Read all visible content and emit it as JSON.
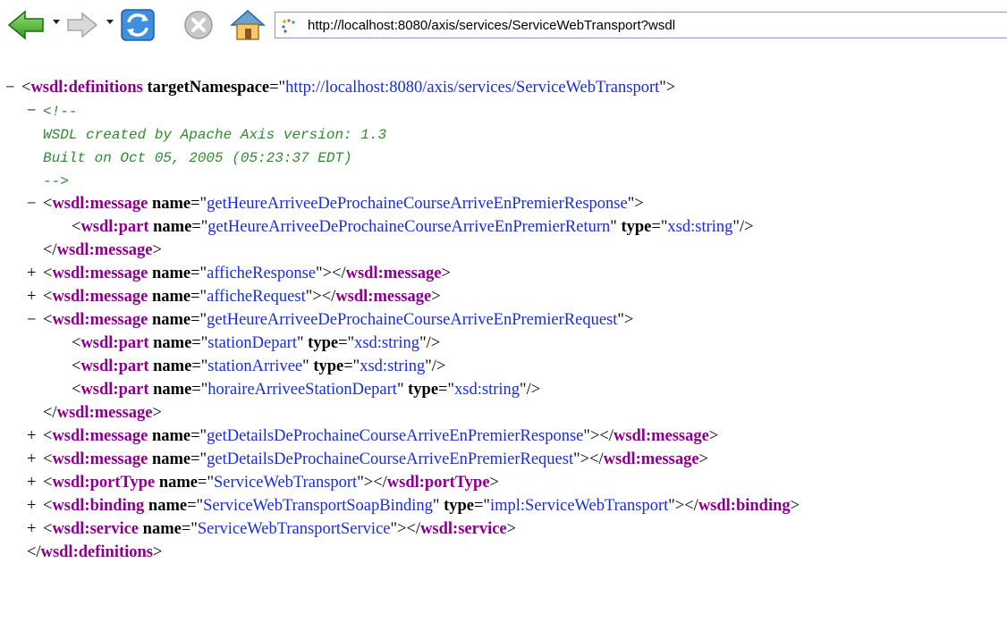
{
  "browser": {
    "url": "http://localhost:8080/axis/services/ServiceWebTransport?wsdl",
    "icons": [
      "back-arrow-icon",
      "forward-arrow-icon",
      "refresh-icon",
      "stop-icon",
      "home-icon",
      "page-icon"
    ]
  },
  "xml": {
    "definitions": {
      "toggle": "−",
      "open_lt": "<",
      "tag": "wsdl:definitions",
      "attr_name": "targetNamespace",
      "attr_value": "http://localhost:8080/axis/services/ServiceWebTransport",
      "close_tag": "wsdl:definitions"
    },
    "comment": {
      "toggle": "−",
      "open": "<!--",
      "line1": "WSDL created by Apache Axis version: 1.3",
      "line2": "Built on Oct 05, 2005 (05:23:37 EDT)",
      "close": "-->"
    },
    "msg1": {
      "toggle": "−",
      "tag": "wsdl:message",
      "attr_name": "name",
      "attr_value": "getHeureArriveeDeProchaineCourseArriveEnPremierResponse",
      "part": {
        "tag": "wsdl:part",
        "name_attr": "name",
        "name_value": "getHeureArriveeDeProchaineCourseArriveEnPremierReturn",
        "type_attr": "type",
        "type_value": "xsd:string"
      },
      "close_tag": "wsdl:message"
    },
    "msg2": {
      "toggle": "+",
      "tag": "wsdl:message",
      "attr_name": "name",
      "attr_value": "afficheResponse",
      "close_tag": "wsdl:message"
    },
    "msg3": {
      "toggle": "+",
      "tag": "wsdl:message",
      "attr_name": "name",
      "attr_value": "afficheRequest",
      "close_tag": "wsdl:message"
    },
    "msg4": {
      "toggle": "−",
      "tag": "wsdl:message",
      "attr_name": "name",
      "attr_value": "getHeureArriveeDeProchaineCourseArriveEnPremierRequest",
      "parts": [
        {
          "tag": "wsdl:part",
          "name_attr": "name",
          "name_value": "stationDepart",
          "type_attr": "type",
          "type_value": "xsd:string"
        },
        {
          "tag": "wsdl:part",
          "name_attr": "name",
          "name_value": "stationArrivee",
          "type_attr": "type",
          "type_value": "xsd:string"
        },
        {
          "tag": "wsdl:part",
          "name_attr": "name",
          "name_value": "horaireArriveeStationDepart",
          "type_attr": "type",
          "type_value": "xsd:string"
        }
      ],
      "close_tag": "wsdl:message"
    },
    "msg5": {
      "toggle": "+",
      "tag": "wsdl:message",
      "attr_name": "name",
      "attr_value": "getDetailsDeProchaineCourseArriveEnPremierResponse",
      "close_tag": "wsdl:message"
    },
    "msg6": {
      "toggle": "+",
      "tag": "wsdl:message",
      "attr_name": "name",
      "attr_value": "getDetailsDeProchaineCourseArriveEnPremierRequest",
      "close_tag": "wsdl:message"
    },
    "porttype": {
      "toggle": "+",
      "tag": "wsdl:portType",
      "attr_name": "name",
      "attr_value": "ServiceWebTransport",
      "close_tag": "wsdl:portType"
    },
    "binding": {
      "toggle": "+",
      "tag": "wsdl:binding",
      "attr_name": "name",
      "attr_value": "ServiceWebTransportSoapBinding",
      "type_attr": "type",
      "type_value": "impl:ServiceWebTransport",
      "close_tag": "wsdl:binding"
    },
    "service": {
      "toggle": "+",
      "tag": "wsdl:service",
      "attr_name": "name",
      "attr_value": "ServiceWebTransportService",
      "close_tag": "wsdl:service"
    }
  }
}
